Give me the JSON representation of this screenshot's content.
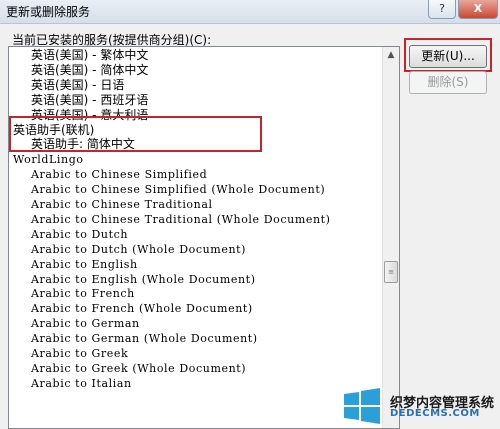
{
  "window": {
    "title": "更新或删除服务",
    "help_label": "?",
    "close_label": "X"
  },
  "list": {
    "label": "当前已安装的服务(按提供商分组)(C):",
    "rows": [
      {
        "text": "英语(美国) - 繁体中文",
        "indent": 1,
        "style": "cjk"
      },
      {
        "text": "英语(美国) - 简体中文",
        "indent": 1,
        "style": "cjk"
      },
      {
        "text": "英语(美国) - 日语",
        "indent": 1,
        "style": "cjk"
      },
      {
        "text": "英语(美国) - 西班牙语",
        "indent": 1,
        "style": "cjk"
      },
      {
        "text": "英语(美国) - 意大利语",
        "indent": 1,
        "style": "cjk"
      },
      {
        "text": "英语助手(联机)",
        "indent": 0,
        "style": "cjk"
      },
      {
        "text": "英语助手: 简体中文",
        "indent": 1,
        "style": "cjk"
      },
      {
        "text": "WorldLingo",
        "indent": 0,
        "style": "mono"
      },
      {
        "text": "Arabic  to Chinese Simplified",
        "indent": 1,
        "style": "mono"
      },
      {
        "text": "Arabic  to Chinese Simplified (Whole Document)",
        "indent": 1,
        "style": "mono"
      },
      {
        "text": "Arabic  to Chinese Traditional",
        "indent": 1,
        "style": "mono"
      },
      {
        "text": "Arabic  to Chinese Traditional (Whole Document)",
        "indent": 1,
        "style": "mono"
      },
      {
        "text": "Arabic  to Dutch",
        "indent": 1,
        "style": "mono"
      },
      {
        "text": "Arabic  to Dutch (Whole Document)",
        "indent": 1,
        "style": "mono"
      },
      {
        "text": "Arabic  to English",
        "indent": 1,
        "style": "mono"
      },
      {
        "text": "Arabic  to English (Whole Document)",
        "indent": 1,
        "style": "mono"
      },
      {
        "text": "Arabic  to French",
        "indent": 1,
        "style": "mono"
      },
      {
        "text": "Arabic  to French (Whole Document)",
        "indent": 1,
        "style": "mono"
      },
      {
        "text": "Arabic  to German",
        "indent": 1,
        "style": "mono"
      },
      {
        "text": "Arabic  to German (Whole Document)",
        "indent": 1,
        "style": "mono"
      },
      {
        "text": "Arabic  to Greek",
        "indent": 1,
        "style": "mono"
      },
      {
        "text": "Arabic  to Greek (Whole Document)",
        "indent": 1,
        "style": "mono"
      },
      {
        "text": "Arabic  to Italian",
        "indent": 1,
        "style": "mono"
      }
    ]
  },
  "buttons": {
    "update_label": "更新(U)...",
    "delete_label": "删除(S)"
  },
  "watermark": {
    "line1": "织梦内容管理系统",
    "line2": "DEDECMS.COM"
  },
  "highlight_color": "#c0272d"
}
